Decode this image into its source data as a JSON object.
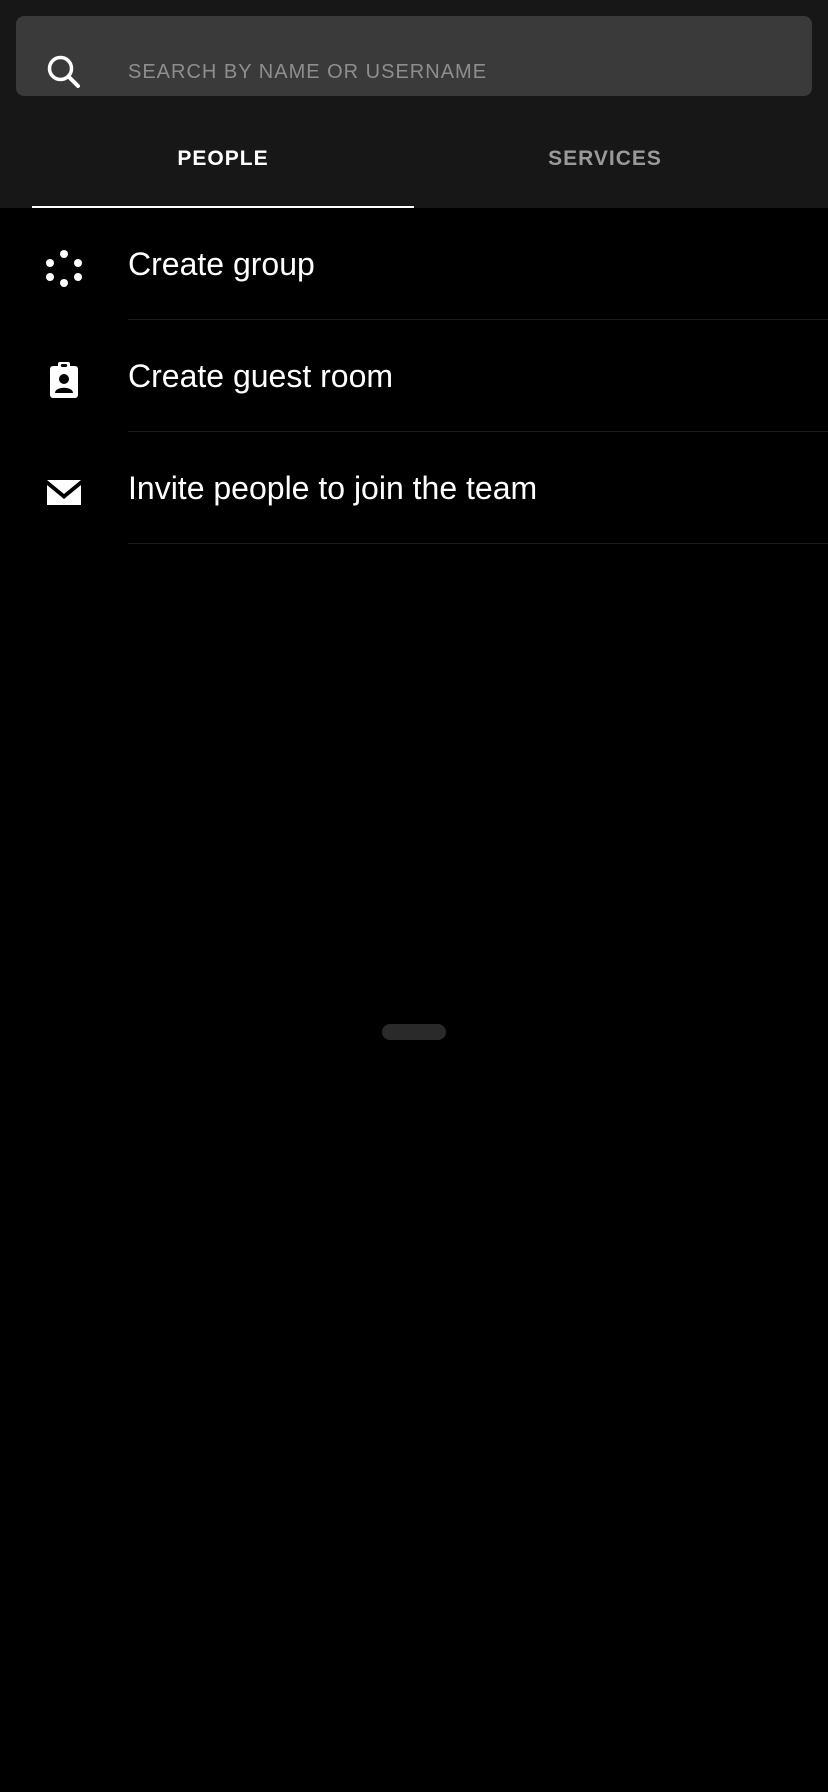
{
  "search": {
    "placeholder": "SEARCH BY NAME OR USERNAME",
    "value": "",
    "icon": "search-icon"
  },
  "tabs": [
    {
      "label": "PEOPLE",
      "selected": true
    },
    {
      "label": "SERVICES",
      "selected": false
    }
  ],
  "actions": [
    {
      "label": "Create group",
      "icon": "group-icon"
    },
    {
      "label": "Create guest room",
      "icon": "guest-badge-icon"
    },
    {
      "label": "Invite people to join the team",
      "icon": "envelope-icon"
    }
  ],
  "colors": {
    "background": "#000000",
    "header": "#171717",
    "search_field": "#3a3a3a",
    "tab_active": "#ffffff",
    "tab_inactive": "#9a9a9a"
  }
}
